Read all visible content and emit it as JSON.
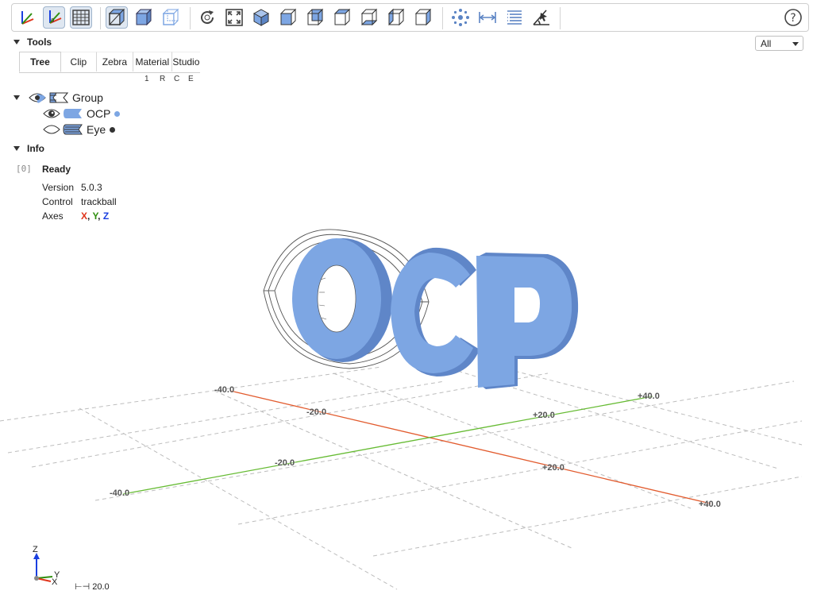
{
  "toolbar": {
    "buttons": [
      {
        "name": "axes-icon"
      },
      {
        "name": "axes-origin-icon"
      },
      {
        "name": "grid-icon"
      },
      {
        "name": "perspective-icon"
      },
      {
        "name": "transparent-icon"
      },
      {
        "name": "blackedges-icon"
      },
      {
        "name": "reset-view-icon"
      },
      {
        "name": "fit-view-icon"
      },
      {
        "name": "iso-view-icon"
      },
      {
        "name": "front-view-icon"
      },
      {
        "name": "rear-view-icon"
      },
      {
        "name": "top-view-icon"
      },
      {
        "name": "bottom-view-icon"
      },
      {
        "name": "left-view-icon"
      },
      {
        "name": "right-view-icon"
      },
      {
        "name": "explode-icon"
      },
      {
        "name": "distance-measure-icon"
      },
      {
        "name": "properties-icon"
      },
      {
        "name": "angle-measure-icon"
      },
      {
        "name": "help-icon"
      }
    ],
    "active": [
      "axes-origin-icon",
      "grid-icon",
      "perspective-icon"
    ],
    "accent": "#7da6e3"
  },
  "select": {
    "value": "All"
  },
  "tools": {
    "title": "Tools",
    "tabs": [
      "Tree",
      "Clip",
      "Zebra",
      "Material",
      "Studio"
    ],
    "selected_tab": "Tree",
    "columns": [
      "1",
      "R",
      "C",
      "E"
    ]
  },
  "tree": {
    "group": {
      "label": "Group"
    },
    "items": [
      {
        "label": "OCP",
        "visible": true,
        "dot_color": "#7da6e3"
      },
      {
        "label": "Eye",
        "visible": false,
        "dot_color": "#333333"
      }
    ]
  },
  "info": {
    "title": "Info",
    "index": "[0]",
    "status": "Ready",
    "rows": [
      {
        "key": "Version",
        "value": "5.0.3"
      },
      {
        "key": "Control",
        "value": "trackball"
      },
      {
        "key": "Axes",
        "value": ""
      }
    ],
    "axes": {
      "x": "X",
      "y": "Y",
      "z": "Z",
      "sep1": ", ",
      "sep2": ", ",
      "x_color": "#e0341b",
      "y_color": "#2f8f0f",
      "z_color": "#1a3fe0"
    }
  },
  "viewport": {
    "object_text": "OCP",
    "object_color": "#7da6e3",
    "grid_labels": {
      "x_neg40": "-40.0",
      "x_neg20": "-20.0",
      "x_pos20": "+20.0",
      "x_pos40": "+40.0",
      "y_neg40": "-40.0",
      "y_neg20": "-20.0",
      "y_pos20": "+20.0",
      "y_pos40": "+40.0"
    },
    "mini_axes": {
      "z": "Z",
      "y": "Y",
      "x": "X"
    },
    "scale_label": "⊢⊣ 20.0"
  }
}
